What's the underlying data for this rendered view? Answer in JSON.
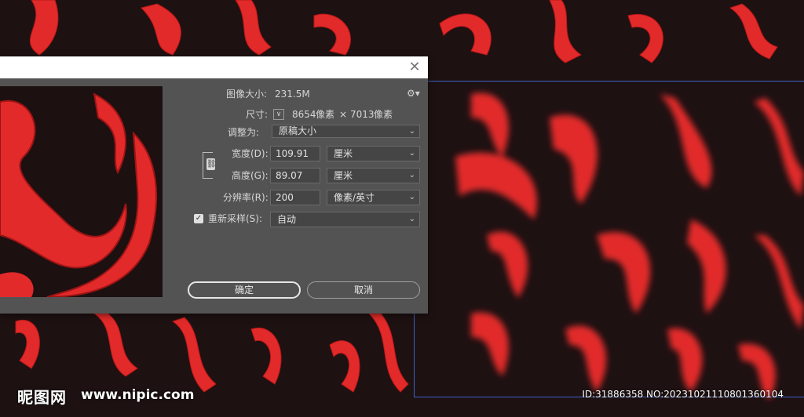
{
  "dialog": {
    "close_glyph": "✕",
    "image_size_label": "图像大小:",
    "image_size_value": "231.5M",
    "settings_icon": "gear-icon",
    "dimensions_label": "尺寸:",
    "dimensions_width": "8654",
    "dimensions_unit1": "像素",
    "dimensions_times": "×",
    "dimensions_height": "7013",
    "dimensions_unit2": "像素",
    "fit_to_label": "调整为:",
    "fit_to_value": "原稿大小",
    "width_label": "宽度(D):",
    "width_value": "109.91",
    "width_unit": "厘米",
    "height_label": "高度(G):",
    "height_value": "89.07",
    "height_unit": "厘米",
    "resolution_label": "分辨率(R):",
    "resolution_value": "200",
    "resolution_unit": "像素/英寸",
    "resample_label": "重新采样(S):",
    "resample_checked": true,
    "resample_value": "自动",
    "ok_label": "确定",
    "cancel_label": "取消"
  },
  "watermark": {
    "logo": "昵图网",
    "url": "www.nipic.com",
    "id": "ID:31886358 NO:20231021110801360104"
  },
  "colors": {
    "canvas_bg": "#1e1112",
    "swirl_red": "#e22a2a",
    "dialog_bg": "#535353",
    "selection_blue": "#3c62c8"
  }
}
